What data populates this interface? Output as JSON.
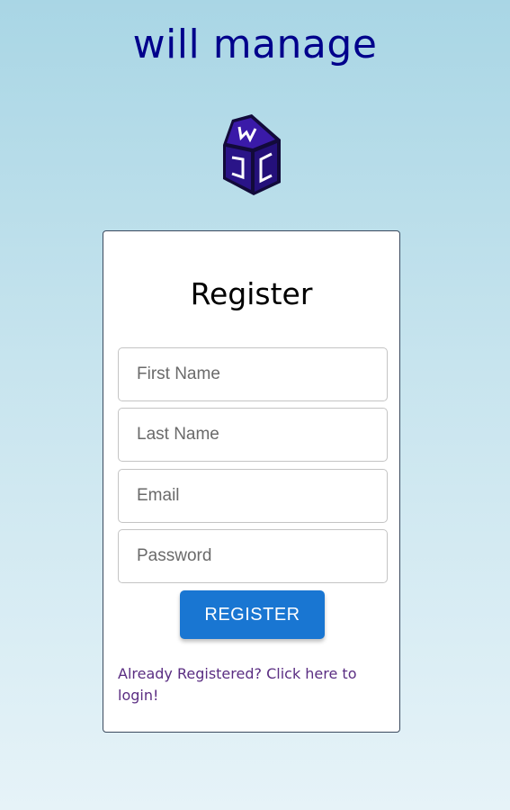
{
  "app": {
    "title": "will manage"
  },
  "logo": {
    "icon": "wjc-house-logo",
    "colors": {
      "primary": "#3a1aa8",
      "dark": "#120a3a",
      "lines": "#ffffff"
    }
  },
  "register_form": {
    "title": "Register",
    "fields": {
      "first_name": {
        "placeholder": "First Name",
        "value": ""
      },
      "last_name": {
        "placeholder": "Last Name",
        "value": ""
      },
      "email": {
        "placeholder": "Email",
        "value": ""
      },
      "password": {
        "placeholder": "Password",
        "value": ""
      }
    },
    "submit_label": "REGISTER",
    "login_link": "Already Registered? Click here to login!"
  },
  "colors": {
    "title": "#00008b",
    "button": "#1976d2",
    "link": "#5a2d82"
  }
}
